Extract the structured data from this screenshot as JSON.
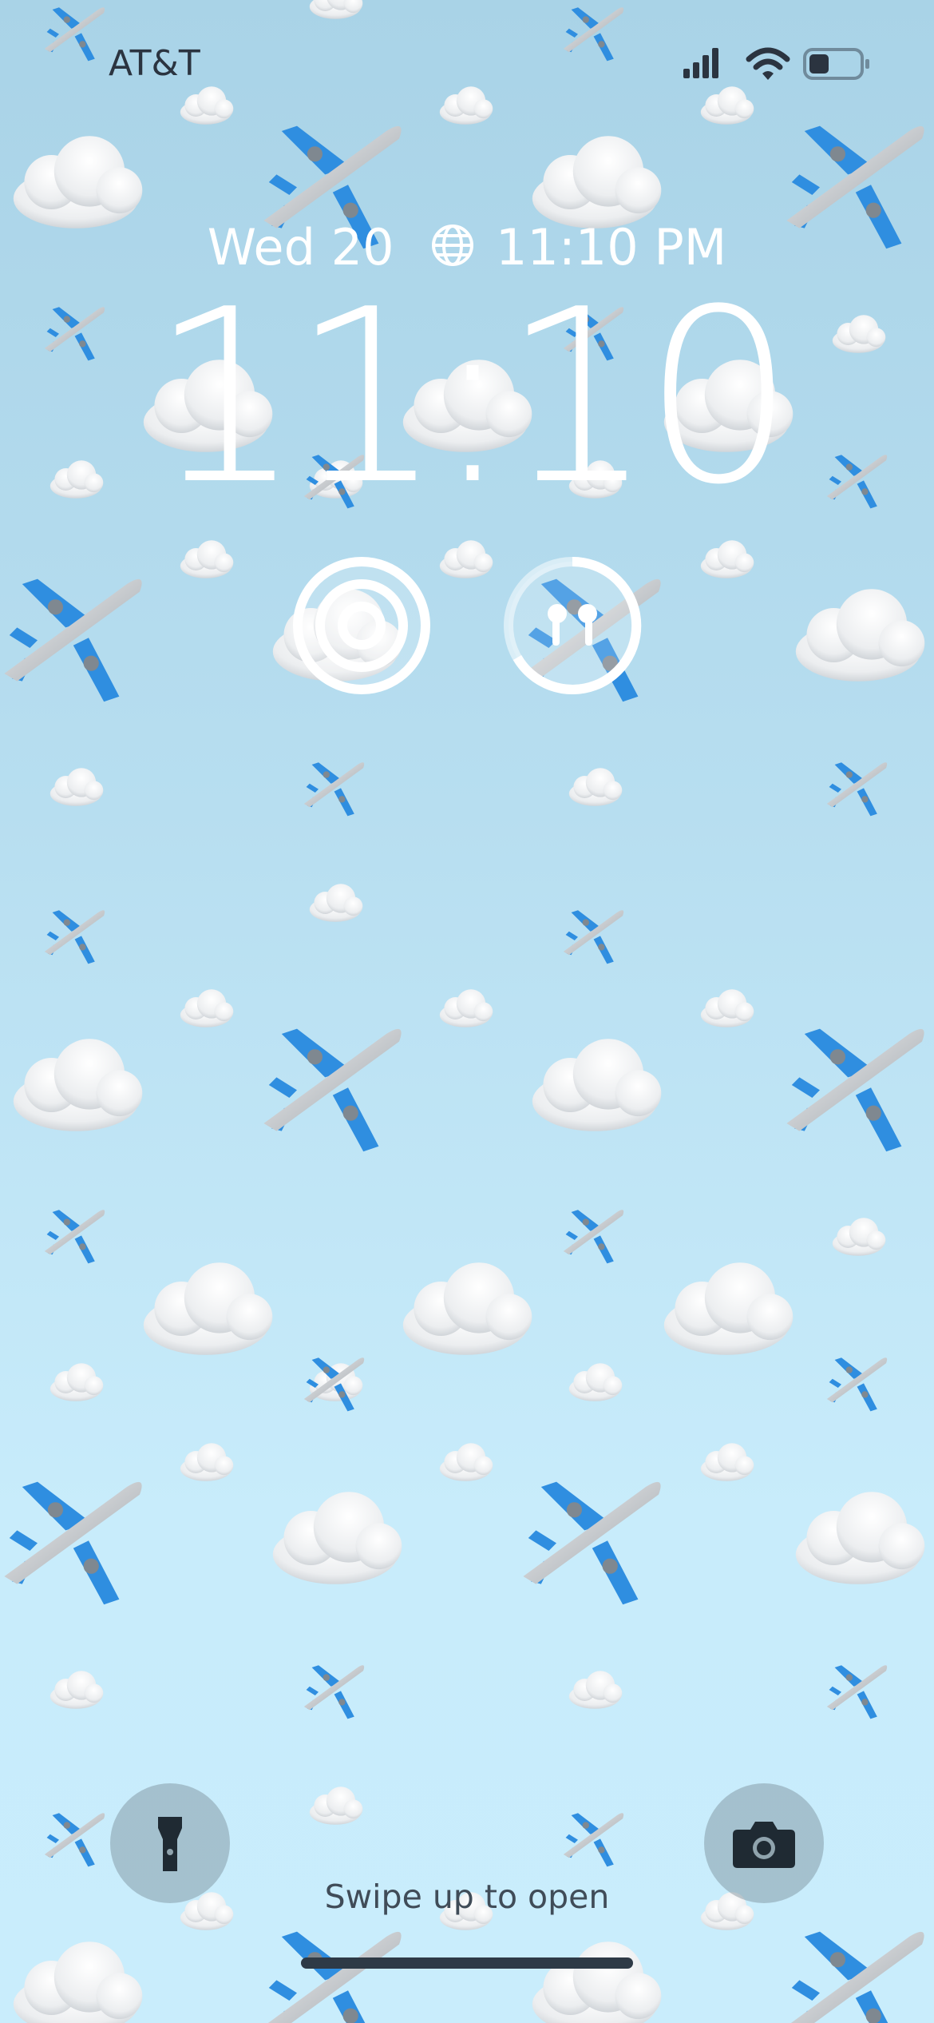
{
  "status_bar": {
    "carrier": "AT&T",
    "signal_icon": "cellular-signal-icon",
    "wifi_icon": "wifi-icon",
    "battery_icon": "battery-icon",
    "battery_level": 0.4
  },
  "lock_screen": {
    "date": "Wed 20",
    "world_clock_icon": "globe-icon",
    "world_clock_time": "11:10 PM",
    "time": "11:10",
    "widgets": [
      {
        "name": "focus-widget",
        "icon": "focus-rings-icon"
      },
      {
        "name": "airpods-battery-widget",
        "icon": "airpods-icon"
      }
    ]
  },
  "bottom": {
    "flashlight_icon": "flashlight-icon",
    "camera_icon": "camera-icon",
    "swipe_hint": "Swipe up to open"
  },
  "colors": {
    "sky_top": "#a9d3e7",
    "sky_bottom": "#c9edfc",
    "clock_text": "#ffffff",
    "plane_blue": "#2f8ee0"
  }
}
